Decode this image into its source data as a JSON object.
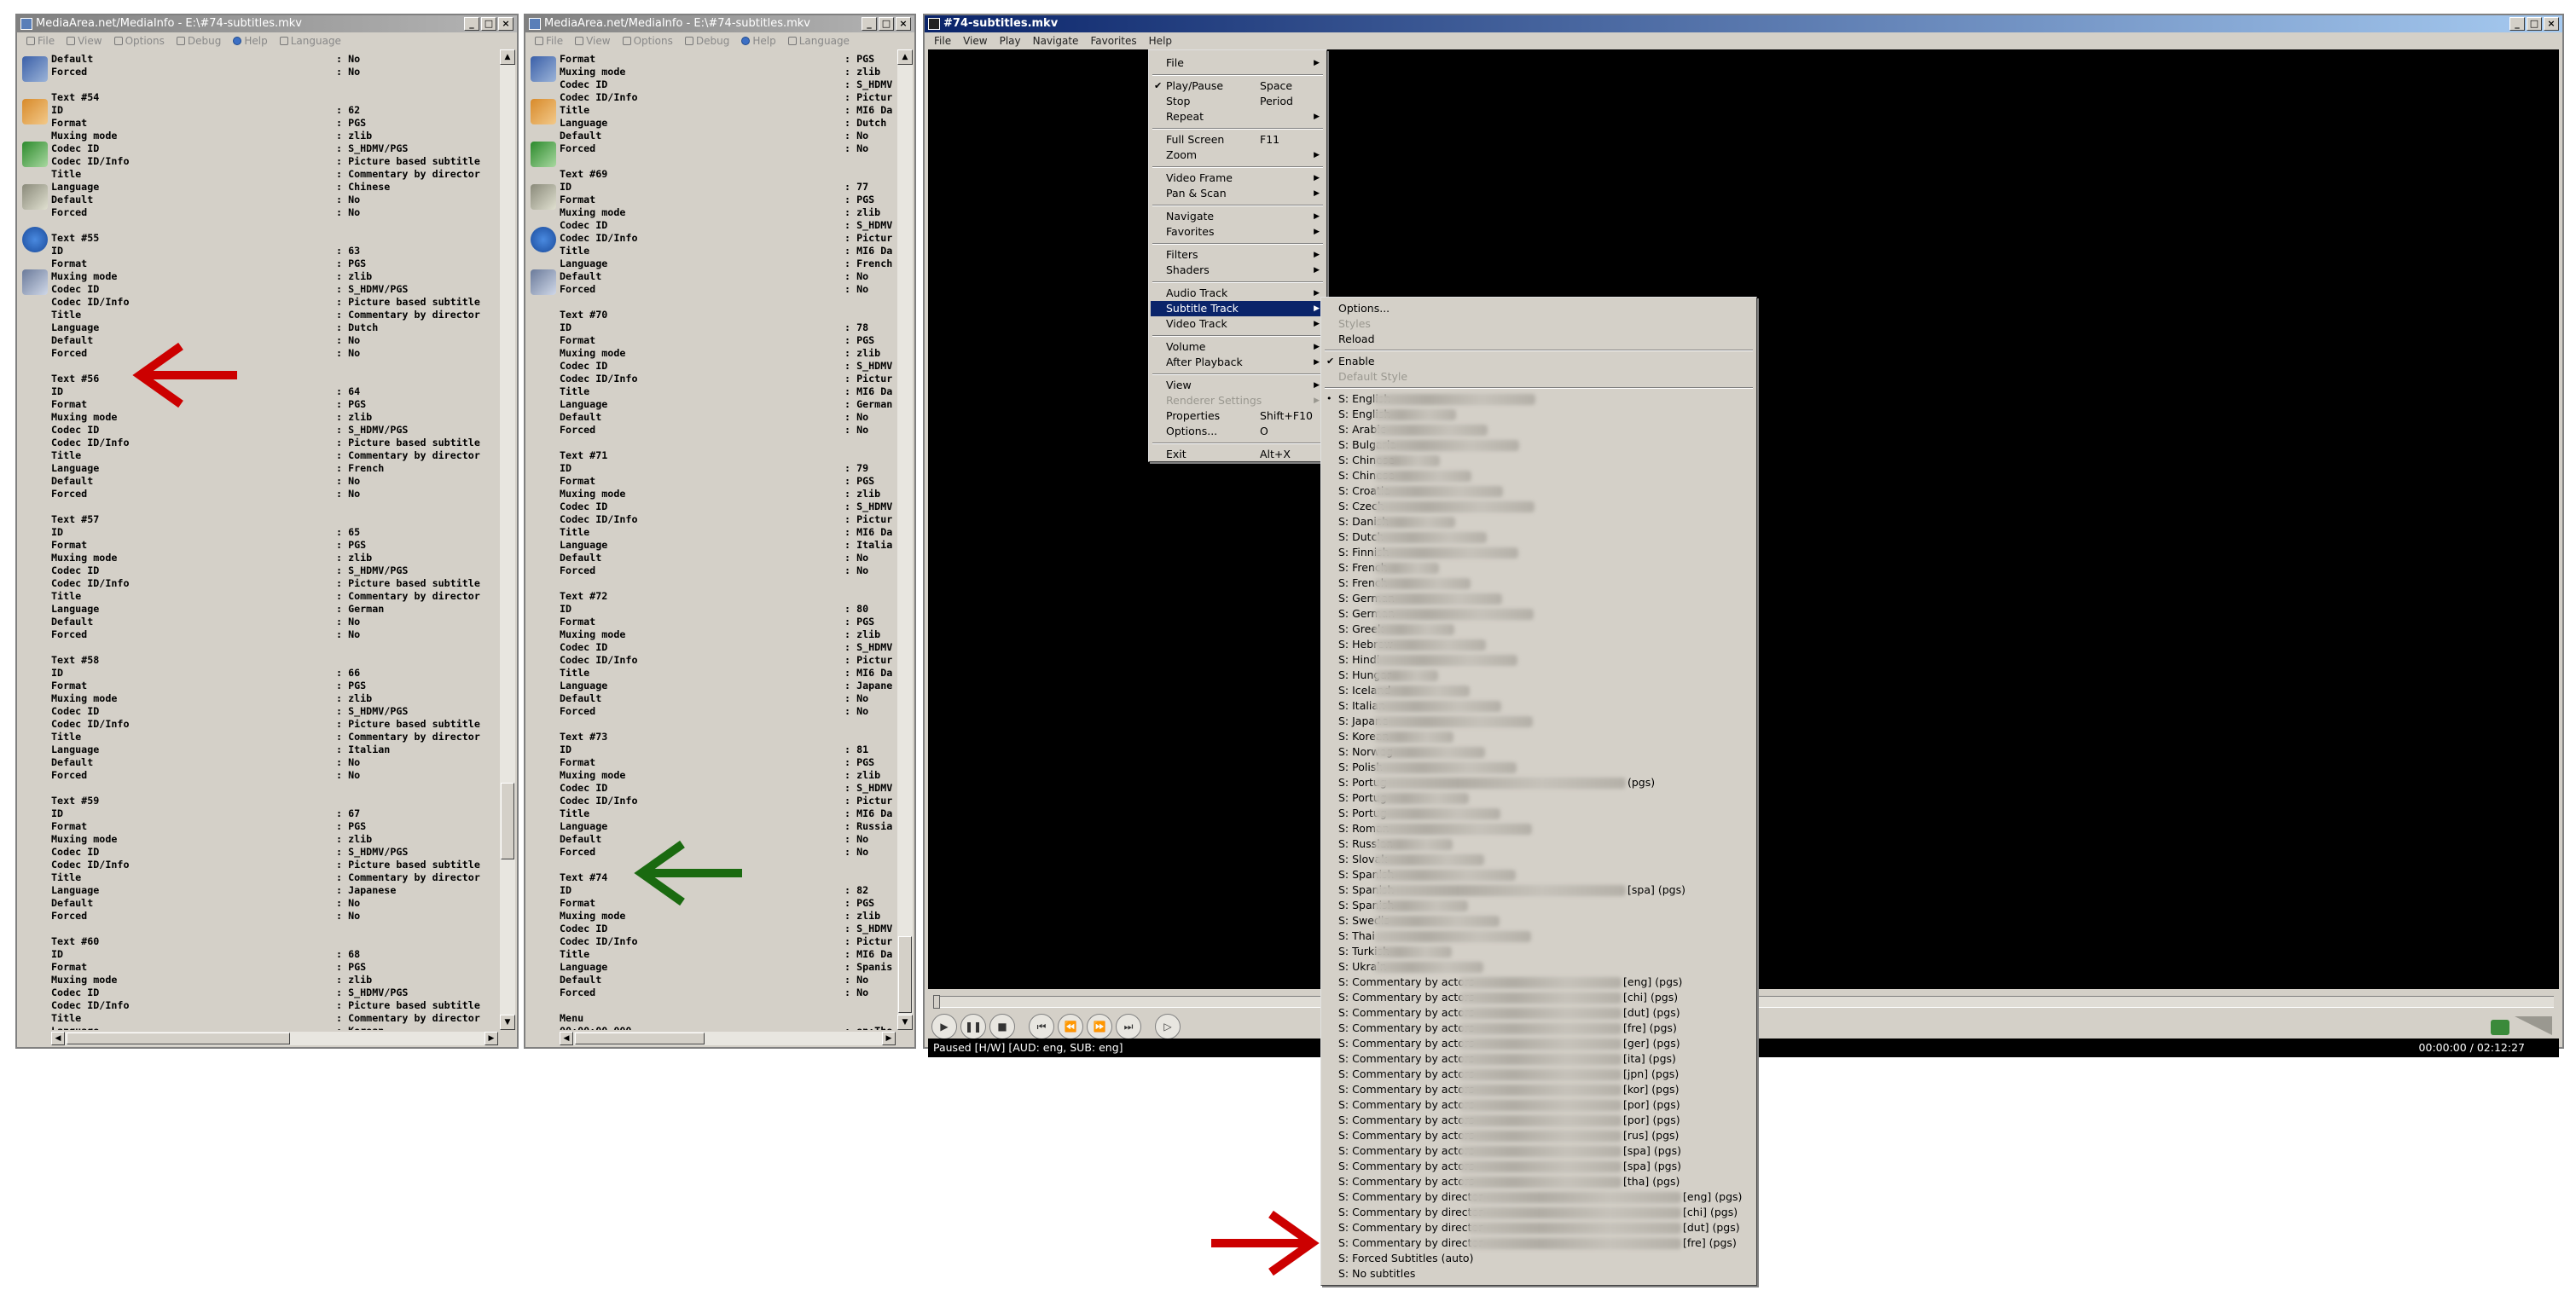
{
  "mediainfo_left": {
    "title": "MediaArea.net/MediaInfo - E:\\#74-subtitles.mkv",
    "menu": [
      "File",
      "View",
      "Options",
      "Debug",
      "Help",
      "Language"
    ],
    "lines": [
      [
        "Default",
        ": No"
      ],
      [
        "Forced",
        ": No"
      ],
      [
        "",
        ""
      ],
      [
        "Text #54",
        ""
      ],
      [
        "ID",
        ": 62"
      ],
      [
        "Format",
        ": PGS"
      ],
      [
        "Muxing mode",
        ": zlib"
      ],
      [
        "Codec ID",
        ": S_HDMV/PGS"
      ],
      [
        "Codec ID/Info",
        ": Picture based subtitle"
      ],
      [
        "Title",
        ": Commentary by director"
      ],
      [
        "Language",
        ": Chinese"
      ],
      [
        "Default",
        ": No"
      ],
      [
        "Forced",
        ": No"
      ],
      [
        "",
        ""
      ],
      [
        "Text #55",
        ""
      ],
      [
        "ID",
        ": 63"
      ],
      [
        "Format",
        ": PGS"
      ],
      [
        "Muxing mode",
        ": zlib"
      ],
      [
        "Codec ID",
        ": S_HDMV/PGS"
      ],
      [
        "Codec ID/Info",
        ": Picture based subtitle"
      ],
      [
        "Title",
        ": Commentary by director"
      ],
      [
        "Language",
        ": Dutch"
      ],
      [
        "Default",
        ": No"
      ],
      [
        "Forced",
        ": No"
      ],
      [
        "",
        ""
      ],
      [
        "Text #56",
        ""
      ],
      [
        "ID",
        ": 64"
      ],
      [
        "Format",
        ": PGS"
      ],
      [
        "Muxing mode",
        ": zlib"
      ],
      [
        "Codec ID",
        ": S_HDMV/PGS"
      ],
      [
        "Codec ID/Info",
        ": Picture based subtitle"
      ],
      [
        "Title",
        ": Commentary by director"
      ],
      [
        "Language",
        ": French"
      ],
      [
        "Default",
        ": No"
      ],
      [
        "Forced",
        ": No"
      ],
      [
        "",
        ""
      ],
      [
        "Text #57",
        ""
      ],
      [
        "ID",
        ": 65"
      ],
      [
        "Format",
        ": PGS"
      ],
      [
        "Muxing mode",
        ": zlib"
      ],
      [
        "Codec ID",
        ": S_HDMV/PGS"
      ],
      [
        "Codec ID/Info",
        ": Picture based subtitle"
      ],
      [
        "Title",
        ": Commentary by director"
      ],
      [
        "Language",
        ": German"
      ],
      [
        "Default",
        ": No"
      ],
      [
        "Forced",
        ": No"
      ],
      [
        "",
        ""
      ],
      [
        "Text #58",
        ""
      ],
      [
        "ID",
        ": 66"
      ],
      [
        "Format",
        ": PGS"
      ],
      [
        "Muxing mode",
        ": zlib"
      ],
      [
        "Codec ID",
        ": S_HDMV/PGS"
      ],
      [
        "Codec ID/Info",
        ": Picture based subtitle"
      ],
      [
        "Title",
        ": Commentary by director"
      ],
      [
        "Language",
        ": Italian"
      ],
      [
        "Default",
        ": No"
      ],
      [
        "Forced",
        ": No"
      ],
      [
        "",
        ""
      ],
      [
        "Text #59",
        ""
      ],
      [
        "ID",
        ": 67"
      ],
      [
        "Format",
        ": PGS"
      ],
      [
        "Muxing mode",
        ": zlib"
      ],
      [
        "Codec ID",
        ": S_HDMV/PGS"
      ],
      [
        "Codec ID/Info",
        ": Picture based subtitle"
      ],
      [
        "Title",
        ": Commentary by director"
      ],
      [
        "Language",
        ": Japanese"
      ],
      [
        "Default",
        ": No"
      ],
      [
        "Forced",
        ": No"
      ],
      [
        "",
        ""
      ],
      [
        "Text #60",
        ""
      ],
      [
        "ID",
        ": 68"
      ],
      [
        "Format",
        ": PGS"
      ],
      [
        "Muxing mode",
        ": zlib"
      ],
      [
        "Codec ID",
        ": S_HDMV/PGS"
      ],
      [
        "Codec ID/Info",
        ": Picture based subtitle"
      ],
      [
        "Title",
        ": Commentary by director"
      ],
      [
        "Language",
        ": Korean"
      ]
    ]
  },
  "mediainfo_mid": {
    "title": "MediaArea.net/MediaInfo - E:\\#74-subtitles.mkv",
    "menu": [
      "File",
      "View",
      "Options",
      "Debug",
      "Help",
      "Language"
    ],
    "lines": [
      [
        "Format",
        ": PGS"
      ],
      [
        "Muxing mode",
        ": zlib"
      ],
      [
        "Codec ID",
        ": S_HDMV"
      ],
      [
        "Codec ID/Info",
        ": Pictur"
      ],
      [
        "Title",
        ": MI6 Da"
      ],
      [
        "Language",
        ": Dutch"
      ],
      [
        "Default",
        ": No"
      ],
      [
        "Forced",
        ": No"
      ],
      [
        "",
        ""
      ],
      [
        "Text #69",
        ""
      ],
      [
        "ID",
        ": 77"
      ],
      [
        "Format",
        ": PGS"
      ],
      [
        "Muxing mode",
        ": zlib"
      ],
      [
        "Codec ID",
        ": S_HDMV"
      ],
      [
        "Codec ID/Info",
        ": Pictur"
      ],
      [
        "Title",
        ": MI6 Da"
      ],
      [
        "Language",
        ": French"
      ],
      [
        "Default",
        ": No"
      ],
      [
        "Forced",
        ": No"
      ],
      [
        "",
        ""
      ],
      [
        "Text #70",
        ""
      ],
      [
        "ID",
        ": 78"
      ],
      [
        "Format",
        ": PGS"
      ],
      [
        "Muxing mode",
        ": zlib"
      ],
      [
        "Codec ID",
        ": S_HDMV"
      ],
      [
        "Codec ID/Info",
        ": Pictur"
      ],
      [
        "Title",
        ": MI6 Da"
      ],
      [
        "Language",
        ": German"
      ],
      [
        "Default",
        ": No"
      ],
      [
        "Forced",
        ": No"
      ],
      [
        "",
        ""
      ],
      [
        "Text #71",
        ""
      ],
      [
        "ID",
        ": 79"
      ],
      [
        "Format",
        ": PGS"
      ],
      [
        "Muxing mode",
        ": zlib"
      ],
      [
        "Codec ID",
        ": S_HDMV"
      ],
      [
        "Codec ID/Info",
        ": Pictur"
      ],
      [
        "Title",
        ": MI6 Da"
      ],
      [
        "Language",
        ": Italia"
      ],
      [
        "Default",
        ": No"
      ],
      [
        "Forced",
        ": No"
      ],
      [
        "",
        ""
      ],
      [
        "Text #72",
        ""
      ],
      [
        "ID",
        ": 80"
      ],
      [
        "Format",
        ": PGS"
      ],
      [
        "Muxing mode",
        ": zlib"
      ],
      [
        "Codec ID",
        ": S_HDMV"
      ],
      [
        "Codec ID/Info",
        ": Pictur"
      ],
      [
        "Title",
        ": MI6 Da"
      ],
      [
        "Language",
        ": Japane"
      ],
      [
        "Default",
        ": No"
      ],
      [
        "Forced",
        ": No"
      ],
      [
        "",
        ""
      ],
      [
        "Text #73",
        ""
      ],
      [
        "ID",
        ": 81"
      ],
      [
        "Format",
        ": PGS"
      ],
      [
        "Muxing mode",
        ": zlib"
      ],
      [
        "Codec ID",
        ": S_HDMV"
      ],
      [
        "Codec ID/Info",
        ": Pictur"
      ],
      [
        "Title",
        ": MI6 Da"
      ],
      [
        "Language",
        ": Russia"
      ],
      [
        "Default",
        ": No"
      ],
      [
        "Forced",
        ": No"
      ],
      [
        "",
        ""
      ],
      [
        "Text #74",
        ""
      ],
      [
        "ID",
        ": 82"
      ],
      [
        "Format",
        ": PGS"
      ],
      [
        "Muxing mode",
        ": zlib"
      ],
      [
        "Codec ID",
        ": S_HDMV"
      ],
      [
        "Codec ID/Info",
        ": Pictur"
      ],
      [
        "Title",
        ": MI6 Da"
      ],
      [
        "Language",
        ": Spanis"
      ],
      [
        "Default",
        ": No"
      ],
      [
        "Forced",
        ": No"
      ],
      [
        "",
        ""
      ],
      [
        "Menu",
        ""
      ],
      [
        "00:00:00.000",
        ": en:The"
      ]
    ]
  },
  "player": {
    "title": "#74-subtitles.mkv",
    "menu": [
      "File",
      "View",
      "Play",
      "Navigate",
      "Favorites",
      "Help"
    ],
    "status_left": "Paused [H/W]   [AUD: eng, SUB: eng]",
    "status_right": "00:00:00 / 02:12:27",
    "control_icons": [
      "play-icon",
      "pause-icon",
      "stop-icon",
      "skip-back-icon",
      "rewind-icon",
      "fast-forward-icon",
      "skip-forward-icon",
      "frame-step-icon"
    ]
  },
  "context_menu": {
    "items": [
      {
        "label": "File",
        "sub": true
      },
      {
        "sep": true
      },
      {
        "label": "Play/Pause",
        "shortcut": "Space",
        "check": true
      },
      {
        "label": "Stop",
        "shortcut": "Period"
      },
      {
        "label": "Repeat",
        "sub": true
      },
      {
        "sep": true
      },
      {
        "label": "Full Screen",
        "shortcut": "F11"
      },
      {
        "label": "Zoom",
        "sub": true
      },
      {
        "sep": true
      },
      {
        "label": "Video Frame",
        "sub": true
      },
      {
        "label": "Pan & Scan",
        "sub": true
      },
      {
        "sep": true
      },
      {
        "label": "Navigate",
        "sub": true
      },
      {
        "label": "Favorites",
        "sub": true
      },
      {
        "sep": true
      },
      {
        "label": "Filters",
        "sub": true
      },
      {
        "label": "Shaders",
        "sub": true
      },
      {
        "sep": true
      },
      {
        "label": "Audio Track",
        "sub": true
      },
      {
        "label": "Subtitle Track",
        "sub": true,
        "selected": true
      },
      {
        "label": "Video Track",
        "sub": true
      },
      {
        "sep": true
      },
      {
        "label": "Volume",
        "sub": true
      },
      {
        "label": "After Playback",
        "sub": true
      },
      {
        "sep": true
      },
      {
        "label": "View",
        "sub": true
      },
      {
        "label": "Renderer Settings",
        "sub": true,
        "disabled": true
      },
      {
        "label": "Properties",
        "shortcut": "Shift+F10"
      },
      {
        "label": "Options...",
        "shortcut": "O"
      },
      {
        "sep": true
      },
      {
        "label": "Exit",
        "shortcut": "Alt+X"
      }
    ]
  },
  "subtitle_menu": {
    "items": [
      {
        "label": "Options..."
      },
      {
        "label": "Styles",
        "disabled": true
      },
      {
        "label": "Reload"
      },
      {
        "sep": true
      },
      {
        "label": "Enable",
        "check": true
      },
      {
        "label": "Default Style",
        "disabled": true
      },
      {
        "sep": true
      },
      {
        "label": "S: English",
        "radio": true
      },
      {
        "label": "S: English"
      },
      {
        "label": "S: Arabic"
      },
      {
        "label": "S: Bulgaria"
      },
      {
        "label": "S: Chinese"
      },
      {
        "label": "S: Chinese"
      },
      {
        "label": "S: Croatia"
      },
      {
        "label": "S: Czech"
      },
      {
        "label": "S: Danish"
      },
      {
        "label": "S: Dutch"
      },
      {
        "label": "S: Finnish"
      },
      {
        "label": "S: French"
      },
      {
        "label": "S: French"
      },
      {
        "label": "S: German"
      },
      {
        "label": "S: German"
      },
      {
        "label": "S: Greek"
      },
      {
        "label": "S: Hebrew"
      },
      {
        "label": "S: Hindi"
      },
      {
        "label": "S: Hungar"
      },
      {
        "label": "S: Iceland"
      },
      {
        "label": "S: Italian"
      },
      {
        "label": "S: Japane"
      },
      {
        "label": "S: Korean"
      },
      {
        "label": "S: Norweg"
      },
      {
        "label": "S: Polish"
      },
      {
        "label": "S: Portug",
        "tail": "(pgs)"
      },
      {
        "label": "S: Portug"
      },
      {
        "label": "S: Portug"
      },
      {
        "label": "S: Roman"
      },
      {
        "label": "S: Russian"
      },
      {
        "label": "S: Slovak"
      },
      {
        "label": "S: Spanish"
      },
      {
        "label": "S: Spanish",
        "tail": "[spa] (pgs)"
      },
      {
        "label": "S: Spanish"
      },
      {
        "label": "S: Swedis"
      },
      {
        "label": "S: Thai"
      },
      {
        "label": "S: Turkish"
      },
      {
        "label": "S: Ukrain"
      },
      {
        "label": "S: Commentary by actors",
        "tail": "[eng] (pgs)"
      },
      {
        "label": "S: Commentary by actors",
        "tail": "[chi] (pgs)"
      },
      {
        "label": "S: Commentary by actors",
        "tail": "[dut] (pgs)"
      },
      {
        "label": "S: Commentary by actors",
        "tail": "[fre] (pgs)"
      },
      {
        "label": "S: Commentary by actors",
        "tail": "[ger] (pgs)"
      },
      {
        "label": "S: Commentary by actors",
        "tail": "[ita] (pgs)"
      },
      {
        "label": "S: Commentary by actors",
        "tail": "[jpn] (pgs)"
      },
      {
        "label": "S: Commentary by actors",
        "tail": "[kor] (pgs)"
      },
      {
        "label": "S: Commentary by actors",
        "tail": "[por] (pgs)"
      },
      {
        "label": "S: Commentary by actors",
        "tail": "[por] (pgs)"
      },
      {
        "label": "S: Commentary by actors",
        "tail": "[rus] (pgs)"
      },
      {
        "label": "S: Commentary by actors",
        "tail": "[spa] (pgs)"
      },
      {
        "label": "S: Commentary by actors",
        "tail": "[spa] (pgs)"
      },
      {
        "label": "S: Commentary by actors",
        "tail": "[tha] (pgs)"
      },
      {
        "label": "S: Commentary by director",
        "tail": "[eng] (pgs)"
      },
      {
        "label": "S: Commentary by director",
        "tail": "[chi] (pgs)"
      },
      {
        "label": "S: Commentary by director",
        "tail": "[dut] (pgs)"
      },
      {
        "label": "S: Commentary by director",
        "tail": "[fre] (pgs)"
      },
      {
        "label": "S: Forced Subtitles (auto)"
      },
      {
        "label": "S: No subtitles"
      }
    ]
  },
  "colors": {
    "title_active": "#0a246a",
    "window_face": "#d4d0c8",
    "arrow_red": "#cc0000",
    "arrow_green": "#1a6a10"
  }
}
